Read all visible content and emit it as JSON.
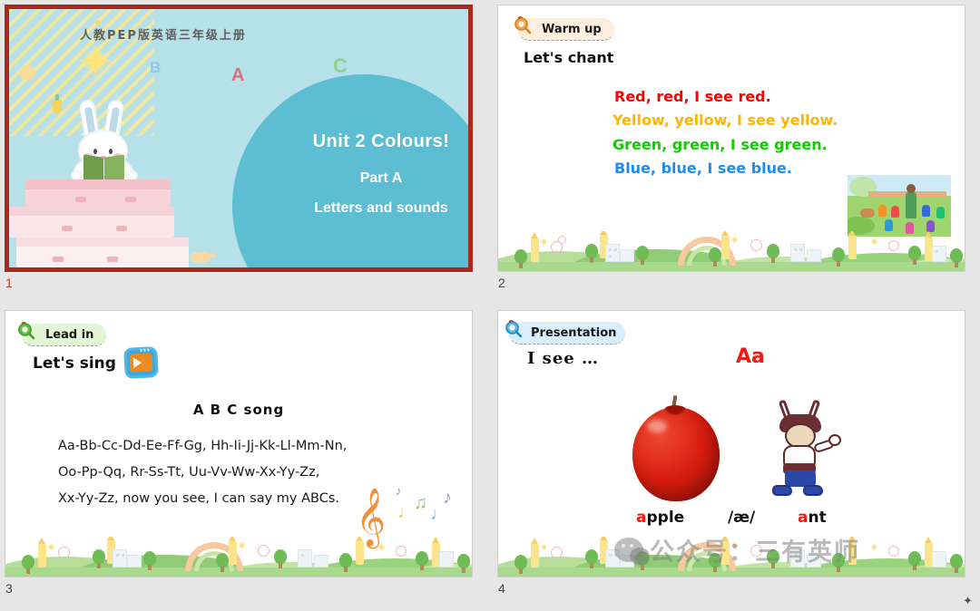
{
  "app": {
    "type": "presentation-slide-grid",
    "selected_slide": 1
  },
  "slides": [
    {
      "number": "1",
      "name": "cover-slide",
      "selected": true,
      "header_cn": "人教PEP版英语三年级上册",
      "title": "Unit 2 Colours!",
      "part": "Part A",
      "subtitle": "Letters and sounds",
      "deco_letters": [
        "B",
        "A",
        "C"
      ],
      "colors": {
        "border": "#a82a1e",
        "background": "#b7e1e9",
        "circle": "#5cbdd3",
        "title_text": "#ffffff"
      }
    },
    {
      "number": "2",
      "name": "warm-up-slide",
      "selected": false,
      "badge": "Warm up",
      "heading": "Let's chant",
      "chant": [
        {
          "text": "Red, red, I see red.",
          "color": "#ff0000"
        },
        {
          "text": "Yellow, yellow, I see yellow.",
          "color": "#ffb400"
        },
        {
          "text": "Green, green, I see green.",
          "color": "#11cc00"
        },
        {
          "text": "Blue, blue, I see blue.",
          "color": "#1b8bf5"
        }
      ],
      "thumbnail_alt": "teacher-and-children-outdoors",
      "colors": {
        "badge_bg": "#fdeedd"
      }
    },
    {
      "number": "3",
      "name": "lead-in-slide",
      "selected": false,
      "badge": "Lead in",
      "heading": "Let's sing",
      "song_title": "A B C song",
      "lyrics": [
        "Aa-Bb-Cc-Dd-Ee-Ff-Gg, Hh-Ii-Jj-Kk-Ll-Mm-Nn,",
        "Oo-Pp-Qq, Rr-Ss-Tt, Uu-Vv-Ww-Xx-Yy-Zz,",
        "Xx-Yy-Zz, now you see, I can say my ABCs."
      ],
      "colors": {
        "badge_bg": "#e2f5d4",
        "play_icon": "#f08a1d"
      }
    },
    {
      "number": "4",
      "name": "presentation-slide",
      "selected": false,
      "badge": "Presentation",
      "heading": "I see …",
      "letter": "Aa",
      "items": [
        {
          "image_alt": "red-apple",
          "label_first": "a",
          "label_rest": "pple"
        },
        {
          "phoneme": "/æ/"
        },
        {
          "image_alt": "cartoon-ant",
          "label_first": "a",
          "label_rest": "nt"
        }
      ],
      "watermark": "公众号：三有英师",
      "colors": {
        "badge_bg": "#d9eefb",
        "letter": "#f21b14"
      }
    }
  ]
}
